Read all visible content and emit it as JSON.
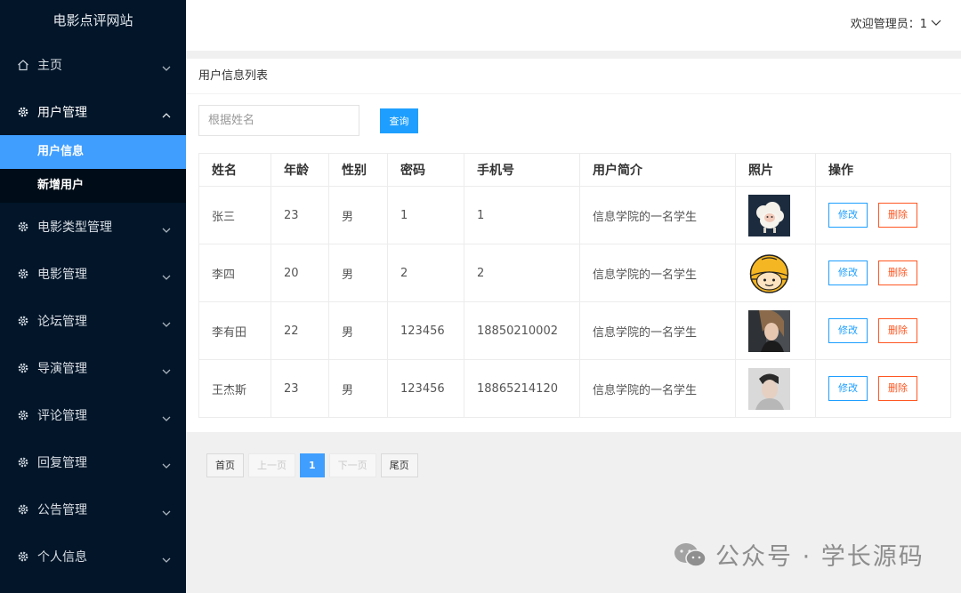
{
  "brand": "电影点评网站",
  "sidebar": {
    "items": [
      {
        "label": "主页",
        "icon": "home-icon"
      },
      {
        "label": "用户管理",
        "icon": "gear-icon",
        "expanded": true,
        "children": [
          {
            "label": "用户信息",
            "active": true
          },
          {
            "label": "新增用户",
            "active": false
          }
        ]
      },
      {
        "label": "电影类型管理",
        "icon": "gear-icon"
      },
      {
        "label": "电影管理",
        "icon": "gear-icon"
      },
      {
        "label": "论坛管理",
        "icon": "gear-icon"
      },
      {
        "label": "导演管理",
        "icon": "gear-icon"
      },
      {
        "label": "评论管理",
        "icon": "gear-icon"
      },
      {
        "label": "回复管理",
        "icon": "gear-icon"
      },
      {
        "label": "公告管理",
        "icon": "gear-icon"
      },
      {
        "label": "个人信息",
        "icon": "gear-icon"
      }
    ]
  },
  "header": {
    "welcome": "欢迎管理员：1"
  },
  "panel": {
    "title": "用户信息列表"
  },
  "search": {
    "placeholder": "根据姓名",
    "value": "",
    "button": "查询"
  },
  "table": {
    "columns": [
      "姓名",
      "年龄",
      "性别",
      "密码",
      "手机号",
      "用户简介",
      "照片",
      "操作"
    ],
    "rows": [
      {
        "name": "张三",
        "age": "23",
        "gender": "男",
        "password": "1",
        "phone": "1",
        "intro": "信息学院的一名学生",
        "photo": "sheep-avatar"
      },
      {
        "name": "李四",
        "age": "20",
        "gender": "男",
        "password": "2",
        "phone": "2",
        "intro": "信息学院的一名学生",
        "photo": "helmet-avatar"
      },
      {
        "name": "李有田",
        "age": "22",
        "gender": "男",
        "password": "123456",
        "phone": "18850210002",
        "intro": "信息学院的一名学生",
        "photo": "woman-portrait"
      },
      {
        "name": "王杰斯",
        "age": "23",
        "gender": "男",
        "password": "123456",
        "phone": "18865214120",
        "intro": "信息学院的一名学生",
        "photo": "man-portrait"
      }
    ],
    "edit_label": "修改",
    "delete_label": "删除"
  },
  "pagination": {
    "first": "首页",
    "prev": "上一页",
    "current": "1",
    "next": "下一页",
    "last": "尾页"
  },
  "watermark": "公众号 · 学长源码",
  "colors": {
    "sidebar": "#021529",
    "active": "#409eff",
    "primary": "#1e9fff",
    "danger": "#ff5722"
  }
}
